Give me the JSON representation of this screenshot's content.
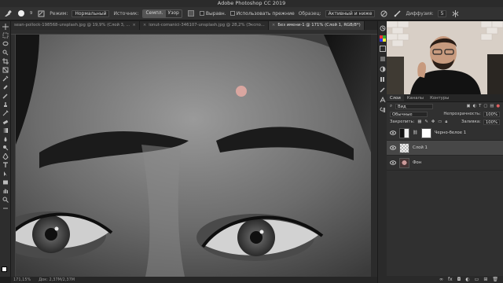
{
  "window": {
    "title": "Adobe Photoshop CC 2019"
  },
  "options_bar": {
    "brush_size": "9",
    "mode_label": "Режим:",
    "mode_value": "Нормальный",
    "source_label": "Источник:",
    "source_sample": "Семпл.",
    "source_pattern": "Узор",
    "aligned_label": "Выравн.",
    "legacy_label": "Использовать прежние",
    "sample_label": "Образец:",
    "sample_value": "Активный и ниже",
    "diffusion_label": "Диффузия:",
    "diffusion_value": "5"
  },
  "tabs": [
    {
      "label": "sean-pollock-198568-unsplash.jpg @ 19,9% (Слой 3, ...",
      "active": false
    },
    {
      "label": "ionut-comanici-346107-unsplash.jpg @ 28,2% (Экспо...",
      "active": false
    },
    {
      "label": "Без имени-1 @ 171% (Слой 1, RGB/8*)",
      "active": true
    }
  ],
  "status_bar": {
    "zoom": "171,15%",
    "doc": "Док: 2,37M/2,37M"
  },
  "layers_panel": {
    "tabs": [
      "Слои",
      "Каналы",
      "Контуры"
    ],
    "filter_label": "Вид",
    "blend_mode": "Обычные",
    "opacity_label": "Непрозрачность:",
    "opacity_value": "100%",
    "lock_label": "Закрепить:",
    "fill_label": "Заливка:",
    "fill_value": "100%",
    "layers": [
      {
        "name": "Черно-белое 1",
        "selected": false
      },
      {
        "name": "Слой 1",
        "selected": true
      },
      {
        "name": "Фон",
        "selected": false
      }
    ]
  },
  "colors": {
    "accent": "#474747",
    "canvas_bg": "#3a3a3a"
  }
}
